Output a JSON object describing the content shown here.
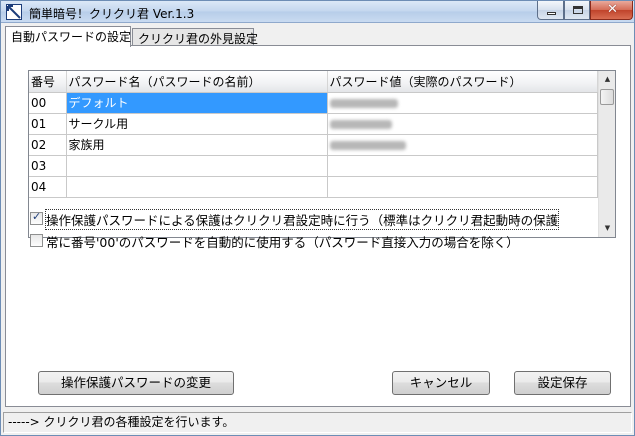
{
  "window": {
    "title": "簡単暗号！クリクリ君  Ver.1.3",
    "controls": {
      "minimize": "minimize-icon",
      "maximize": "maximize-icon",
      "close": "close-icon"
    }
  },
  "tabs": [
    {
      "label": "自動パスワードの設定",
      "active": true
    },
    {
      "label": "クリクリ君の外見設定",
      "active": false
    }
  ],
  "grid": {
    "headers": [
      "番号",
      "パスワード名（パスワードの名前）",
      "パスワード値（実際のパスワード）"
    ],
    "rows": [
      {
        "no": "00",
        "name": "デフォルト",
        "selected": true
      },
      {
        "no": "01",
        "name": "サークル用",
        "selected": false
      },
      {
        "no": "02",
        "name": "家族用",
        "selected": false
      },
      {
        "no": "03",
        "name": "",
        "selected": false
      },
      {
        "no": "04",
        "name": "",
        "selected": false
      }
    ]
  },
  "options": {
    "protect_on_settings": {
      "label": "操作保護パスワードによる保護はクリクリ君設定時に行う（標準はクリクリ君起動時の保護",
      "checked": true
    },
    "always_use_00": {
      "label": "常に番号'00'のパスワードを自動的に使用する（パスワード直接入力の場合を除く）",
      "checked": false
    }
  },
  "buttons": {
    "change_password": "操作保護パスワードの変更",
    "cancel": "キャンセル",
    "save": "設定保存"
  },
  "status": "-----> クリクリ君の各種設定を行います。",
  "colors": {
    "selection": "#3399ff",
    "title_gradient": "#c3d6ee"
  }
}
